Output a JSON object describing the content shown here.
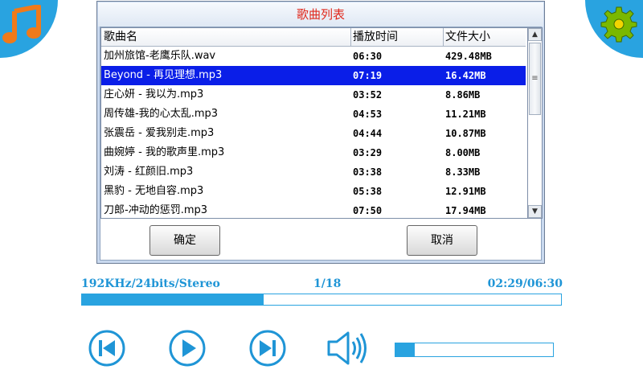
{
  "dialog": {
    "title": "歌曲列表",
    "columns": [
      "歌曲名",
      "播放时间",
      "文件大小"
    ],
    "songs": [
      {
        "name": "加州旅馆-老鹰乐队.wav",
        "time": "06:30",
        "size": "429.48MB",
        "selected": false
      },
      {
        "name": "Beyond - 再见理想.mp3",
        "time": "07:19",
        "size": "16.42MB",
        "selected": true
      },
      {
        "name": "庄心妍 - 我以为.mp3",
        "time": "03:52",
        "size": "8.86MB",
        "selected": false
      },
      {
        "name": "周传雄-我的心太乱.mp3",
        "time": "04:53",
        "size": "11.21MB",
        "selected": false
      },
      {
        "name": "张震岳 - 爱我别走.mp3",
        "time": "04:44",
        "size": "10.87MB",
        "selected": false
      },
      {
        "name": "曲婉婷 - 我的歌声里.mp3",
        "time": "03:29",
        "size": "8.00MB",
        "selected": false
      },
      {
        "name": "刘涛 - 红颜旧.mp3",
        "time": "03:38",
        "size": "8.33MB",
        "selected": false
      },
      {
        "name": "黑豹 - 无地自容.mp3",
        "time": "05:38",
        "size": "12.91MB",
        "selected": false
      },
      {
        "name": "刀郎-冲动的惩罚.mp3",
        "time": "07:50",
        "size": "17.94MB",
        "selected": false
      }
    ],
    "ok_label": "确定",
    "cancel_label": "取消"
  },
  "status": {
    "format": "192KHz/24bits/Stereo",
    "track": "1/18",
    "time": "02:29/06:30"
  },
  "playback_progress": 0.38,
  "volume_level": 0.12,
  "colors": {
    "accent": "#29a3e0",
    "selection": "#0a1ee8",
    "title_text": "#e0281c",
    "music_icon": "#f07a1a",
    "gear_icon": "#7ab800"
  },
  "icons": {
    "top_left": "music-note-icon",
    "top_right": "gear-icon",
    "prev": "skip-previous-icon",
    "play": "play-icon",
    "next": "skip-next-icon",
    "volume": "speaker-icon"
  }
}
